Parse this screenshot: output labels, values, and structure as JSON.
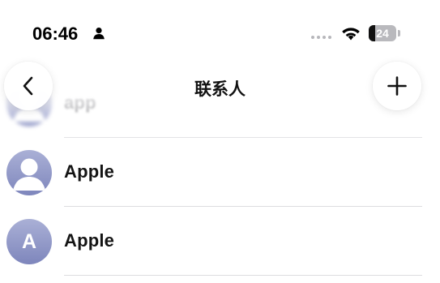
{
  "status_bar": {
    "time": "06:46",
    "person_icon": "person-fill-icon",
    "signal_icon": "cellular-signal-dots-icon",
    "wifi_icon": "wifi-icon",
    "battery_level": 24,
    "battery_text": "24"
  },
  "nav": {
    "title": "联系人",
    "back_icon": "chevron-left-icon",
    "add_icon": "plus-icon"
  },
  "contacts": [
    {
      "name": "app",
      "avatar": "placeholder-person"
    },
    {
      "name": "Apple",
      "avatar": "placeholder-person"
    },
    {
      "name": "Apple",
      "avatar_initial": "A"
    }
  ],
  "colors": {
    "avatar_top": "#aab0d6",
    "avatar_bottom": "#7e86bc",
    "divider": "#dcdcdf"
  }
}
